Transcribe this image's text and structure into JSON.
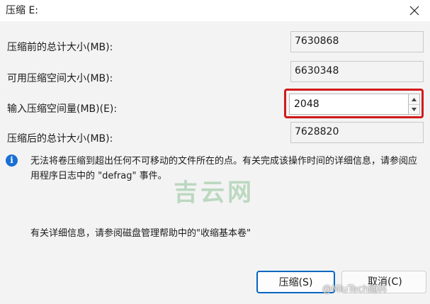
{
  "window": {
    "title": "压缩 E:"
  },
  "fields": {
    "total_before": {
      "label": "压缩前的总计大小(MB):",
      "value": "7630868"
    },
    "available": {
      "label": "可用压缩空间大小(MB):",
      "value": "6630348"
    },
    "input": {
      "label": "输入压缩空间量(MB)(E):",
      "value": "2048"
    },
    "total_after": {
      "label": "压缩后的总计大小(MB):",
      "value": "7628820"
    }
  },
  "info": {
    "message": "无法将卷压缩到超出任何不可移动的文件所在的点。有关完成该操作时间的详细信息，请参阅应用程序日志中的 \"defrag\" 事件。",
    "help": "有关详细信息，请参阅磁盘管理帮助中的\"收缩基本卷\""
  },
  "watermark": "吉云网",
  "buttons": {
    "shrink": "压缩(S)",
    "cancel": "取消(C)"
  },
  "credit": "@MiuTech随科",
  "colors": {
    "highlight": "#d11a1a",
    "primary_border": "#0067c0",
    "info_icon": "#1a6fd2"
  }
}
